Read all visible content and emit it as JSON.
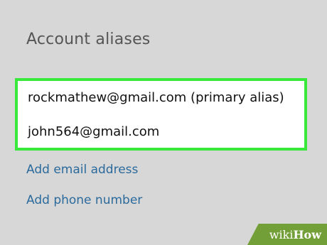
{
  "section": {
    "title": "Account aliases"
  },
  "aliases": {
    "items": [
      "rockmathew@gmail.com (primary alias)",
      "john564@gmail.com"
    ]
  },
  "actions": {
    "add_email": "Add email address",
    "add_phone": "Add phone number"
  },
  "watermark": {
    "wiki": "wiki",
    "how": "How"
  },
  "colors": {
    "background": "#d7d7d7",
    "highlight_border": "#38e83a",
    "link": "#2a6a9c",
    "watermark_bg": "#6a9a2a"
  }
}
